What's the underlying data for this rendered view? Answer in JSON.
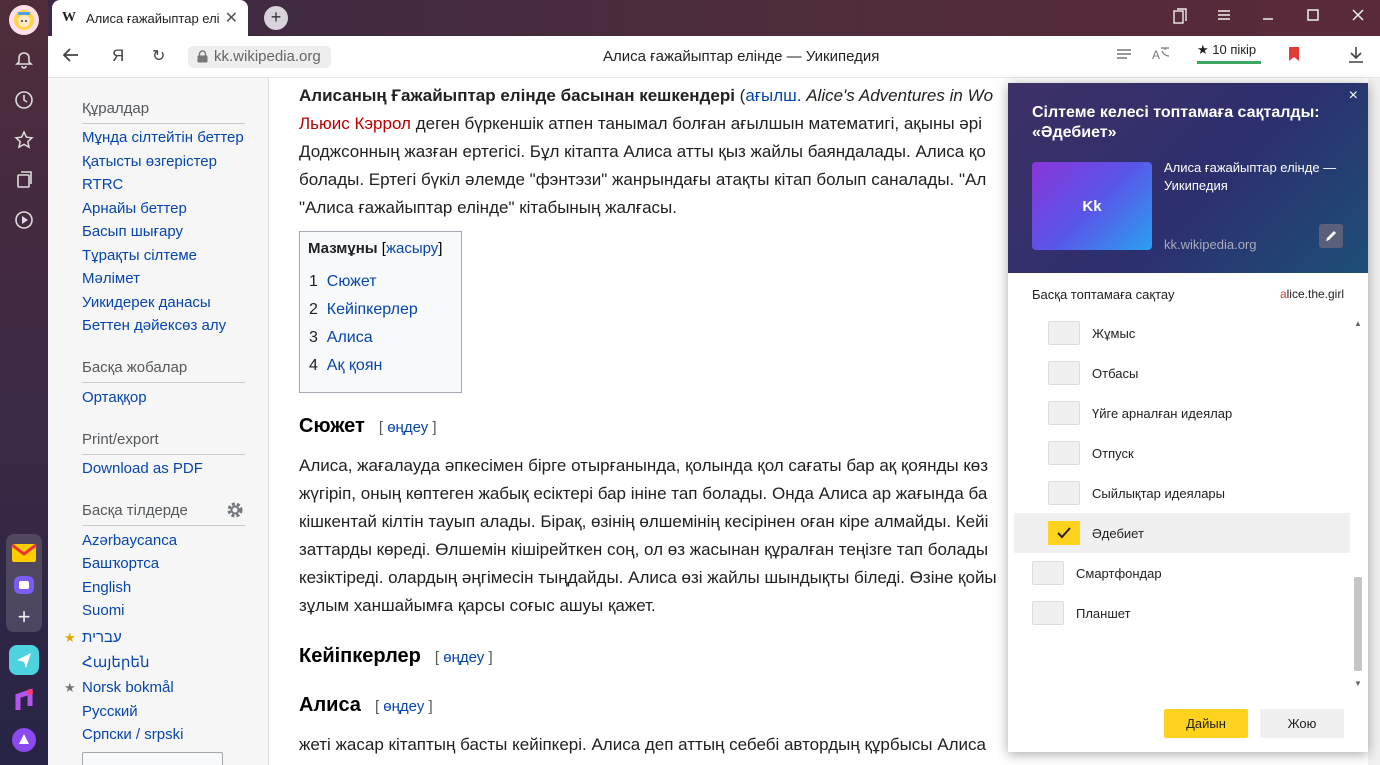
{
  "browser": {
    "tab_title": "Алиса ғажайыптар елін",
    "tab_logo": "W",
    "tab_close": "✕",
    "new_tab": "+",
    "url": "kk.wikipedia.org",
    "page_title": "Алиса ғажайыптар елінде — Уикипедия",
    "reviews": "★ 10 пікір",
    "back_icon": "back-arrow-icon",
    "yandex": "Я",
    "reload": "↻"
  },
  "sidebar": {
    "tools_heading": "Құралдар",
    "tools": [
      "Мұнда сілтейтін беттер",
      "Қатысты өзгерістер",
      "RTRC",
      "Арнайы беттер",
      "Басып шығару",
      "Тұрақты сілтеме",
      "Мәлімет",
      "Уикидерек данасы",
      "Беттен дәйексөз алу"
    ],
    "projects_heading": "Басқа жобалар",
    "projects": [
      "Ортаққор"
    ],
    "print_heading": "Print/export",
    "print": [
      "Download as PDF"
    ],
    "langs_heading": "Басқа тілдерде",
    "langs": [
      "Azərbaycanca",
      "Башҡортса",
      "English",
      "Suomi",
      "עברית",
      "Հայերեն",
      "Norsk bokmål",
      "Русский",
      "Српски / srpski"
    ]
  },
  "article": {
    "l1_bold": "Алисаның Ғажайыптар елінде басынан кешкендері",
    "l1_paren": " (",
    "l1_lang": "ағылш.",
    "l1_italic": " Alice's Adventures in Wo",
    "l2_red": "Льюис Кэррол",
    "l2_rest": " деген бүркеншік атпен танымал болған ағылшын математигі, ақыны әрі",
    "l3": "Доджсонның жазған ертегісі. Бұл кітапта Алиса атты қыз жайлы баяндалады. Алиса қо",
    "l4": "болады. Ертегі бүкіл әлемде \"фэнтэзи\" жанрындағы атақты кітап болып саналады. \"Ал",
    "l5": "\"Алиса ғажайыптар елінде\" кітабының жалғасы.",
    "toc_title": "Мазмұны",
    "toc_bracket_open": " [",
    "toc_hide": "жасыру",
    "toc_bracket_close": "]",
    "toc": [
      {
        "num": "1",
        "label": "Сюжет"
      },
      {
        "num": "2",
        "label": "Кейіпкерлер"
      },
      {
        "num": "3",
        "label": "Алиса"
      },
      {
        "num": "4",
        "label": "Ақ қоян"
      }
    ],
    "h_plot": "Сюжет",
    "edit_open": "[ ",
    "edit_label": "өңдеу",
    "edit_close": " ]",
    "plot": [
      "Алиса, жағалауда әпкесімен бірге отырғанында, қолында қол сағаты бар ақ қоянды көз",
      "жүгіріп, оның көптеген жабық есіктері бар ініне тап болады. Онда Алиса ар жағында ба",
      "кішкентай кілтін тауып алады. Бірақ, өзінің өлшемінің кесірінен оған кіре алмайды. Кейі",
      "заттарды көреді. Өлшемін кішірейткен соң, ол өз жасынан құралған теңізге тап болады",
      "кезіктіреді. олардың әңгімесін тыңдайды. Алиса өзі жайлы шындықты біледі. Өзіне қойы",
      "зұлым ханшайымға қарсы соғыс ашуы қажет."
    ],
    "h_chars": "Кейіпкерлер",
    "h_alice": "Алиса",
    "alice_text": "жеті жасар кітаптың басты кейіпкері. Алиса деп аттың себебі автордың құрбысы Алиса"
  },
  "popup": {
    "title": "Сілтеме келесі топтамаға сақталды: «Әдебиет»",
    "close": "×",
    "thumb_label": "Kk",
    "page_title": "Алиса ғажайыптар елінде — Уикипедия",
    "page_url": "kk.wikipedia.org",
    "other_label": "Басқа топтамаға сақтау",
    "user_first": "a",
    "user_rest": "lice.the.girl",
    "folders": [
      "Жұмыс",
      "Отбасы",
      "Үйге арналған идеялар",
      "Отпуск",
      "Сыйлықтар идеялары",
      "Әдебиет",
      "Смартфондар",
      "Планшет"
    ],
    "selected_folder": "Әдебиет",
    "done": "Дайын",
    "close_btn": "Жою"
  },
  "colors": {
    "accent": "#ffd21e",
    "link": "#0645ad",
    "redlink": "#ba0000"
  }
}
